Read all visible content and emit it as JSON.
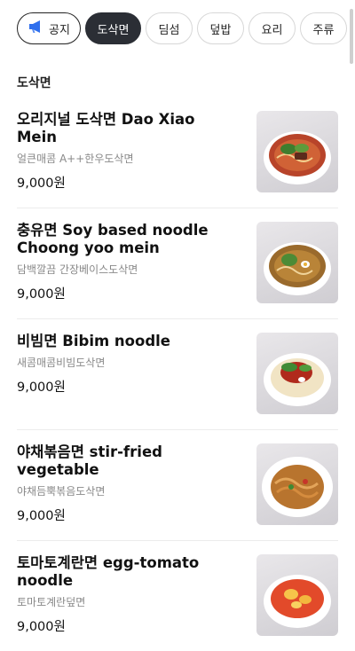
{
  "tabs": [
    {
      "label": "공지",
      "icon": "megaphone-icon"
    },
    {
      "label": "도삭면",
      "active": true
    },
    {
      "label": "딤섬"
    },
    {
      "label": "덮밥"
    },
    {
      "label": "요리"
    },
    {
      "label": "주류"
    }
  ],
  "section": {
    "title": "도삭면"
  },
  "items": [
    {
      "name": "오리지널 도삭면 Dao Xiao Mein",
      "desc": "얼큰매콤 A++한우도삭면",
      "price": "9,000원",
      "image": "beef-noodle-soup-bowl"
    },
    {
      "name": "충유면 Soy based noodle Choong yoo mein",
      "desc": "담백깔끔 간장베이스도삭면",
      "price": "9,000원",
      "image": "soy-noodle-soup-bowl"
    },
    {
      "name": "비빔면 Bibim noodle",
      "desc": "새콤매콤비빔도삭면",
      "price": "9,000원",
      "image": "bibim-noodle-bowl"
    },
    {
      "name": "야채볶음면 stir-fried vegetable",
      "desc": "야채듬뿍볶음도삭면",
      "price": "9,000원",
      "image": "stir-fried-noodle-plate"
    },
    {
      "name": "토마토계란면 egg-tomato noodle",
      "desc": "토마토계란덮면",
      "price": "9,000원",
      "image": "tomato-egg-noodle-bowl"
    }
  ],
  "colors": {
    "active_tab_bg": "#2b2e35",
    "notice_icon": "#2f6fed",
    "divider": "#ececec",
    "desc_text": "#888888"
  }
}
